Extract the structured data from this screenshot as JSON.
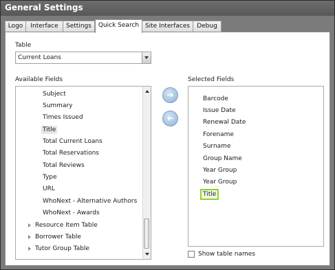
{
  "window": {
    "title": "General Settings"
  },
  "tabs": [
    "Logo",
    "Interface",
    "Settings",
    "Quick Search",
    "Site Interfaces",
    "Debug"
  ],
  "active_tab": "Quick Search",
  "table": {
    "label": "Table",
    "value": "Current Loans"
  },
  "available": {
    "label": "Available Fields",
    "items": [
      "Subject",
      "Summary",
      "Times Issued",
      "Title",
      "Total Current Loans",
      "Total Reservations",
      "Total Reviews",
      "Type",
      "URL",
      "WhoNext - Alternative Authors",
      "WhoNext - Awards"
    ],
    "highlighted": "Title",
    "groups": [
      "Resource Item Table",
      "Borrower Table",
      "Tutor Group Table"
    ]
  },
  "buttons": {
    "add": "➜",
    "remove": "➜"
  },
  "selected": {
    "label": "Selected Fields",
    "items": [
      "Barcode",
      "Issue Date",
      "Renewal Date",
      "Forename",
      "Surname",
      "Group Name",
      "Year Group",
      "Year Group",
      "Title"
    ],
    "highlighted": "Title"
  },
  "show_table_names": {
    "label": "Show table names",
    "checked": false
  }
}
